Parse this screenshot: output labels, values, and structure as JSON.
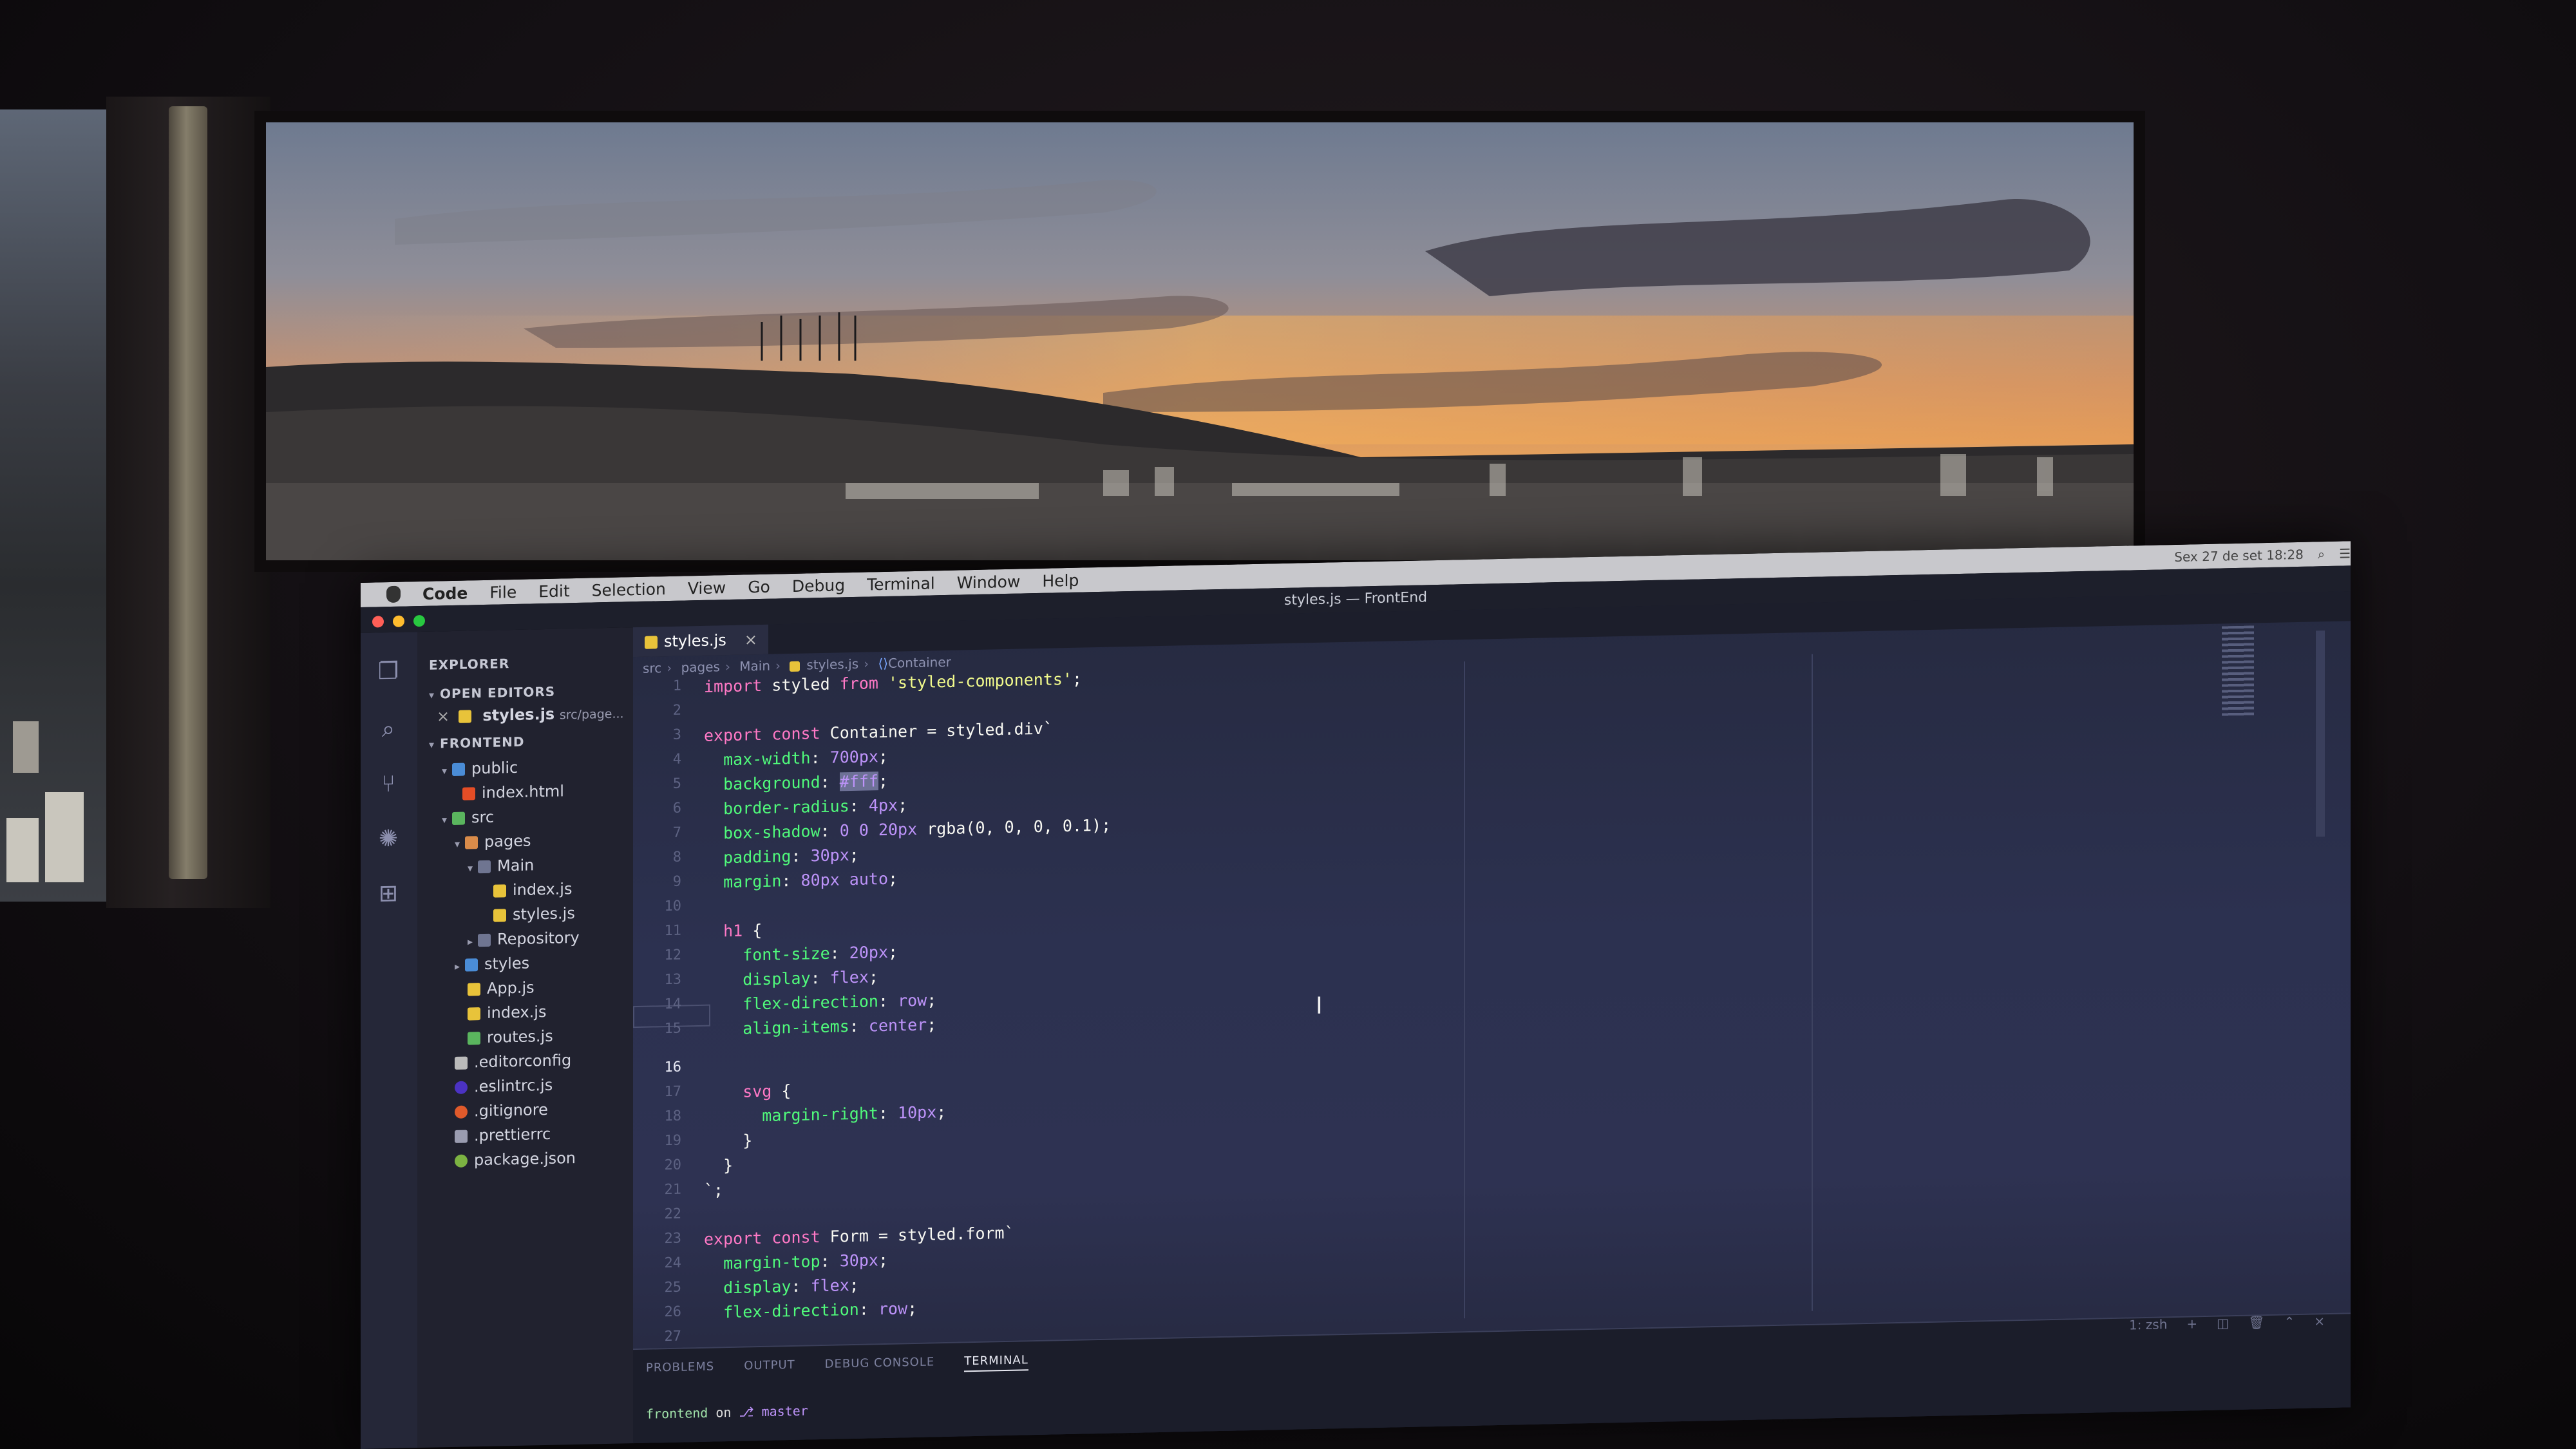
{
  "menubar": {
    "items": [
      "Code",
      "File",
      "Edit",
      "Selection",
      "View",
      "Go",
      "Debug",
      "Terminal",
      "Window",
      "Help"
    ],
    "clock": "Sex 27 de set 18:28"
  },
  "window": {
    "title": "styles.js — FrontEnd"
  },
  "explorer": {
    "title": "EXPLORER",
    "open_editors": "OPEN EDITORS",
    "open_file": "styles.js",
    "open_file_path": "src/page...",
    "project": "FRONTEND",
    "tree": [
      {
        "label": "public",
        "kind": "folder"
      },
      {
        "label": "index.html",
        "kind": "html"
      },
      {
        "label": "src",
        "kind": "folder"
      },
      {
        "label": "pages",
        "kind": "folder"
      },
      {
        "label": "Main",
        "kind": "folder"
      },
      {
        "label": "index.js",
        "kind": "js"
      },
      {
        "label": "styles.js",
        "kind": "js"
      },
      {
        "label": "Repository",
        "kind": "folder"
      },
      {
        "label": "styles",
        "kind": "folder"
      },
      {
        "label": "App.js",
        "kind": "js"
      },
      {
        "label": "index.js",
        "kind": "js"
      },
      {
        "label": "routes.js",
        "kind": "config"
      },
      {
        "label": ".editorconfig",
        "kind": "config"
      },
      {
        "label": ".eslintrc.js",
        "kind": "config"
      },
      {
        "label": ".gitignore",
        "kind": "config"
      },
      {
        "label": ".prettierrc",
        "kind": "config"
      },
      {
        "label": "package.json",
        "kind": "config"
      }
    ]
  },
  "editor": {
    "tab_label": "styles.js",
    "tab_close": "×",
    "breadcrumbs": [
      "src",
      "pages",
      "Main",
      "styles.js",
      "Container"
    ],
    "current_line": "16",
    "line_numbers": [
      "1",
      "2",
      "3",
      "4",
      "5",
      "6",
      "7",
      "8",
      "9",
      "10",
      "11",
      "12",
      "13",
      "14",
      "15",
      "16",
      "17",
      "18",
      "19",
      "20",
      "21",
      "22",
      "23",
      "24",
      "25",
      "26",
      "27"
    ]
  },
  "code": {
    "l1_kw": "import",
    "l1_id": " styled ",
    "l1_kw2": "from",
    "l1_str": " 'styled-components'",
    "l1_end": ";",
    "l3_kw": "export const",
    "l3_id": " Container = styled.div`",
    "l4_p": "  max-width",
    "l4_v": " 700px",
    "l4_e": ";",
    "l5_p": "  background",
    "l5_v": "#fff",
    "l5_e": ";",
    "l6_p": "  border-radius",
    "l6_v": " 4px",
    "l6_e": ";",
    "l7_p": "  box-shadow",
    "l7_v": " 0 0 20px",
    "l7_f": " rgba(0, 0, 0, 0.1);",
    "l8_p": "  padding",
    "l8_v": " 30px",
    "l8_e": ";",
    "l9_p": "  margin",
    "l9_v": " 80px auto",
    "l9_e": ";",
    "l11_s": "  h1",
    "l11_e": " {",
    "l12_p": "    font-size",
    "l12_v": " 20px",
    "l12_e": ";",
    "l13_p": "    display",
    "l13_v": " flex",
    "l13_e": ";",
    "l14_p": "    flex-direction",
    "l14_v": " row",
    "l14_e": ";",
    "l15_p": "    align-items",
    "l15_v": " center",
    "l15_e": ";",
    "l17_s": "    svg",
    "l17_e": " {",
    "l18_p": "      margin-right",
    "l18_v": " 10px",
    "l18_e": ";",
    "l19": "    }",
    "l20": "  }",
    "l21": "`;",
    "l23_kw": "export const",
    "l23_id": " Form = styled.form`",
    "l24_p": "  margin-top",
    "l24_v": " 30px",
    "l24_e": ";",
    "l25_p": "  display",
    "l25_v": " flex",
    "l25_e": ";",
    "l26_p": "  flex-direction",
    "l26_v": " row",
    "l26_e": ";"
  },
  "panel": {
    "tabs": [
      "PROBLEMS",
      "OUTPUT",
      "DEBUG CONSOLE",
      "TERMINAL"
    ],
    "terminal_select": "1: zsh",
    "prompt_dir": "frontend",
    "prompt_on": " on ",
    "prompt_branch": "master"
  },
  "colors": {
    "keyword": "#ff79c6",
    "string": "#f1fa8c",
    "property": "#50fa7b",
    "number": "#bd93f9",
    "editor_bg": "#2c3150",
    "sidebar_bg": "#21222f"
  }
}
